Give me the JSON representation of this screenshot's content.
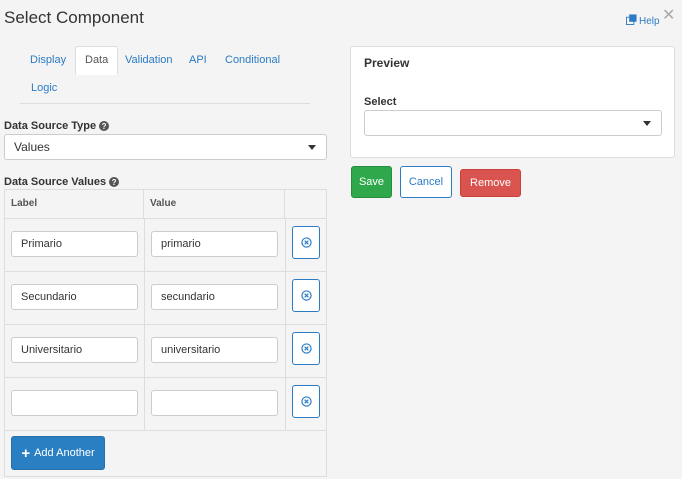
{
  "header": {
    "title": "Select Component",
    "help_label": "Help",
    "close_glyph": "✕"
  },
  "tabs": [
    {
      "label": "Display",
      "active": false
    },
    {
      "label": "Data",
      "active": true
    },
    {
      "label": "Validation",
      "active": false
    },
    {
      "label": "API",
      "active": false
    },
    {
      "label": "Conditional",
      "active": false
    },
    {
      "label": "Logic",
      "active": false
    }
  ],
  "data_source_type": {
    "label": "Data Source Type",
    "value": "Values"
  },
  "data_source_values": {
    "label": "Data Source Values",
    "columns": [
      "Label",
      "Value"
    ],
    "rows": [
      {
        "label": "Primario",
        "value": "primario"
      },
      {
        "label": "Secundario",
        "value": "secundario"
      },
      {
        "label": "Universitario",
        "value": "universitario"
      },
      {
        "label": "",
        "value": ""
      }
    ],
    "add_label": "Add Another"
  },
  "preview": {
    "title": "Preview",
    "select_label": "Select",
    "select_value": ""
  },
  "actions": {
    "save": "Save",
    "cancel": "Cancel",
    "remove": "Remove"
  },
  "colors": {
    "primary": "#2b7bc4",
    "save": "#2ea84b",
    "remove": "#d9534f"
  }
}
